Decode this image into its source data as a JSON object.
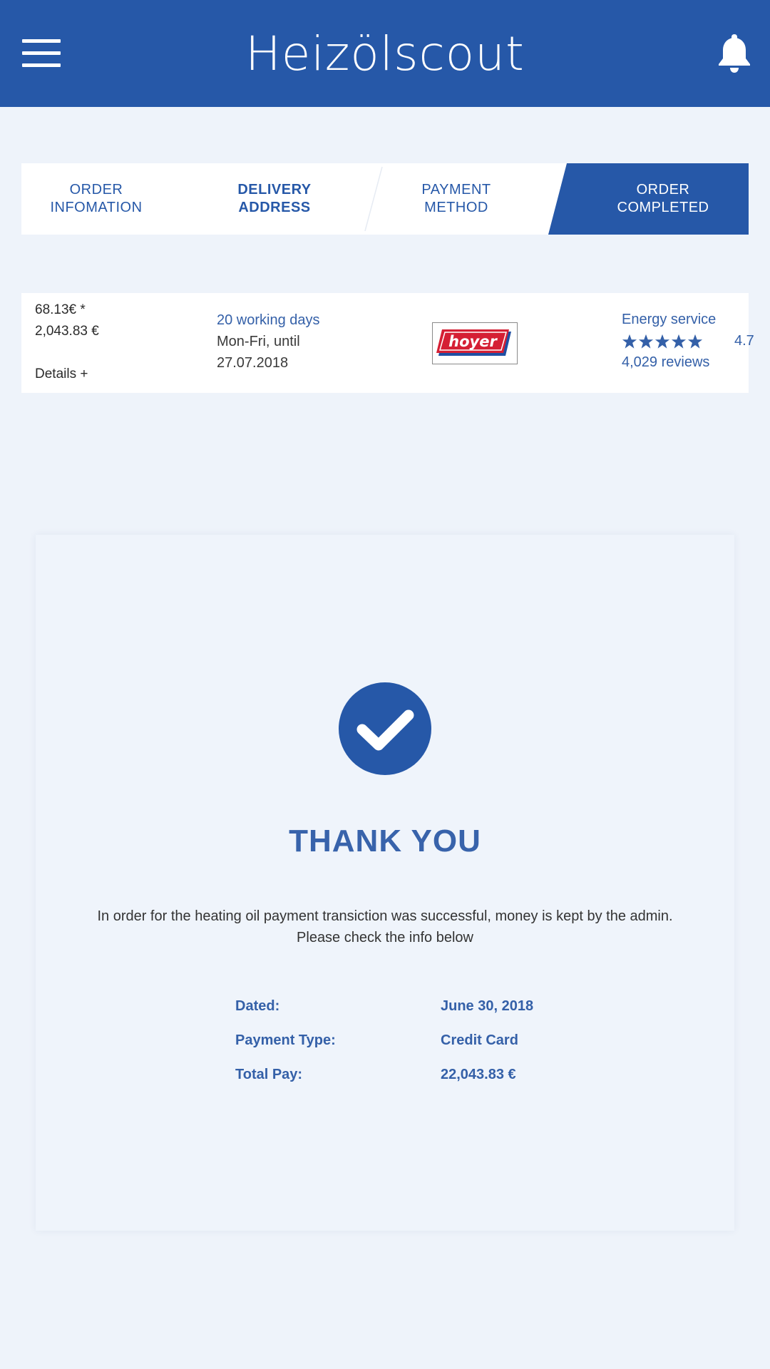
{
  "header": {
    "logo_text": "Heizölscout",
    "menu_icon": "hamburger-menu-icon",
    "notification_icon": "bell-icon",
    "background_color": "#2658a8"
  },
  "steps": [
    {
      "line1": "ORDER",
      "line2": "INFOMATION",
      "state": "default"
    },
    {
      "line1": "DELIVERY",
      "line2": "ADDRESS",
      "state": "bold"
    },
    {
      "line1": "PAYMENT",
      "line2": "METHOD",
      "state": "default"
    },
    {
      "line1": "ORDER",
      "line2": "COMPLETED",
      "state": "active"
    }
  ],
  "offer": {
    "price_per_unit": "68.13€ *",
    "price_total": "2,043.83 €",
    "details_link": "Details +",
    "delivery_days": "20 working days",
    "delivery_window": "Mon-Fri, until",
    "delivery_date": "27.07.2018",
    "dealer_logo_text": "hoyer",
    "provider_name": "Energy service",
    "star_count": 5,
    "rating": "4.7",
    "reviews": "4,029 reviews"
  },
  "confirmation": {
    "icon": "checkmark-circle-icon",
    "title": "THANK YOU",
    "message_line1": "In order for the heating oil payment transiction was successful, money is kept by the admin.",
    "message_line2": "Please check the info below",
    "rows": [
      {
        "label": "Dated:",
        "value": "June 30, 2018"
      },
      {
        "label": "Payment Type:",
        "value": "Credit Card"
      },
      {
        "label": "Total Pay:",
        "value": "22,043.83 €"
      }
    ]
  },
  "colors": {
    "primary": "#2658a8",
    "page_background": "#eef3fa",
    "dealer_red": "#d51f34"
  }
}
